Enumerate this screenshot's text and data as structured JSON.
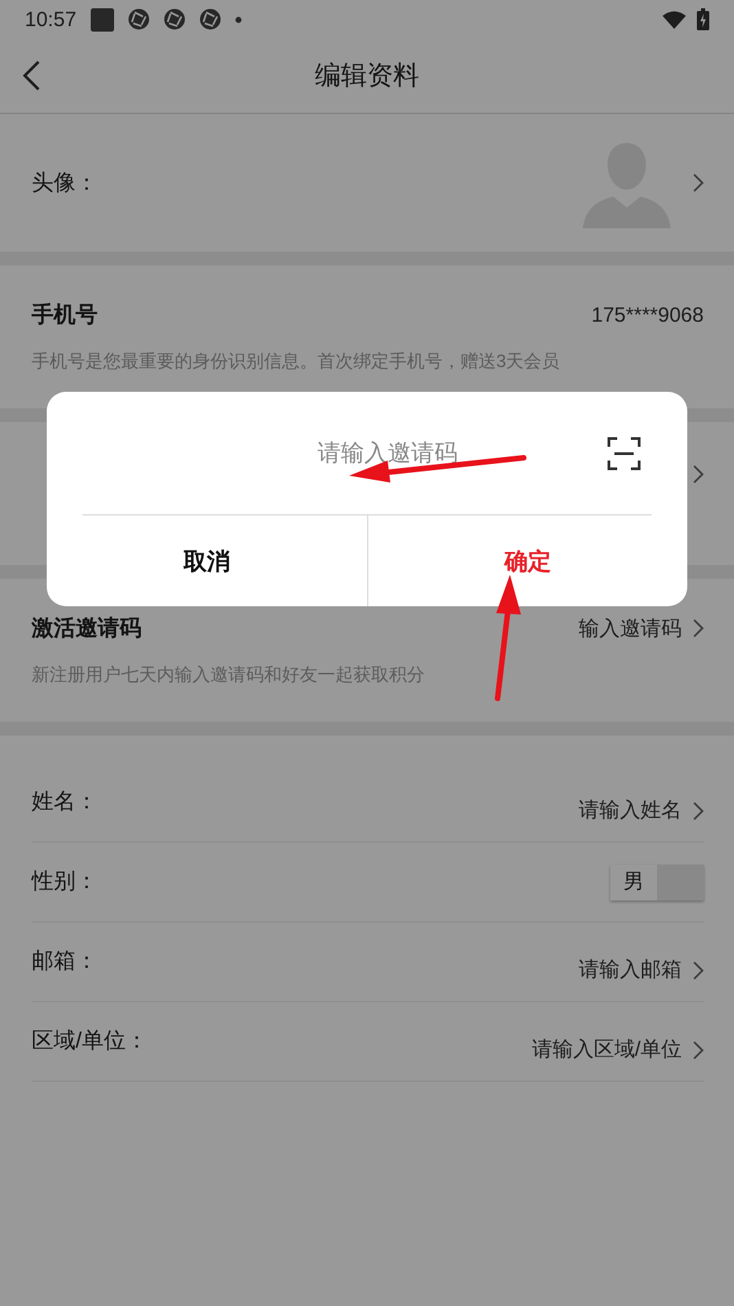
{
  "status_bar": {
    "time": "10:57"
  },
  "header": {
    "title": "编辑资料"
  },
  "avatar_row": {
    "label": "头像："
  },
  "sections": [
    {
      "title": "手机号",
      "value": "175****9068",
      "chevron": false,
      "description": "手机号是您最重要的身份识别信息。首次绑定手机号，赠送3天会员"
    },
    {
      "chevron": true
    },
    {
      "title": "激活邀请码",
      "value": "输入邀请码",
      "chevron": true,
      "description": "新注册用户七天内输入邀请码和好友一起获取积分"
    }
  ],
  "fields": [
    {
      "kind": "link",
      "label": "姓名：",
      "value": "请输入姓名"
    },
    {
      "kind": "toggle",
      "label": "性别：",
      "value": "男"
    },
    {
      "kind": "link",
      "label": "邮箱：",
      "value": "请输入邮箱"
    },
    {
      "kind": "link",
      "label": "区域/单位：",
      "value": "请输入区域/单位"
    }
  ],
  "dialog": {
    "placeholder": "请输入邀请码",
    "buttons": [
      {
        "kind": "cancel",
        "label": "取消"
      },
      {
        "kind": "confirm",
        "label": "确定"
      }
    ]
  }
}
